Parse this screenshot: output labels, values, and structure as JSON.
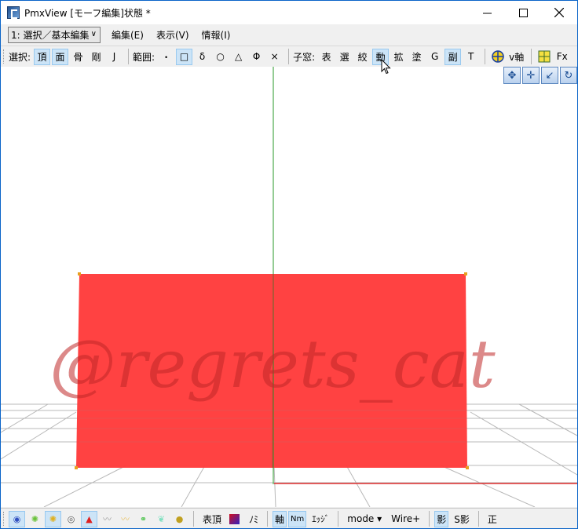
{
  "window": {
    "title": "PmxView  [モーフ編集]状態 *"
  },
  "titlebar": {
    "minimize": "—",
    "maximize": "☐",
    "close": "✕"
  },
  "menubar": {
    "mode_select": "1: 選択／基本編集",
    "items": [
      "編集(E)",
      "表示(V)",
      "情報(I)"
    ]
  },
  "toolbar": {
    "select_label": "選択:",
    "select_buttons": [
      {
        "label": "頂",
        "active": true
      },
      {
        "label": "面",
        "active": true
      },
      {
        "label": "骨",
        "active": false
      },
      {
        "label": "剛",
        "active": false
      },
      {
        "label": "J",
        "active": false
      }
    ],
    "range_label": "範囲:",
    "range_buttons": [
      {
        "label": "・",
        "active": false
      },
      {
        "label": "□",
        "active": true
      },
      {
        "label": "δ",
        "active": false
      },
      {
        "label": "○",
        "active": false
      },
      {
        "label": "△",
        "active": false
      },
      {
        "label": "Φ",
        "active": false
      },
      {
        "label": "×",
        "active": false
      }
    ],
    "child_label": "子窓:",
    "child_buttons": [
      {
        "label": "表",
        "active": false
      },
      {
        "label": "選",
        "active": false
      },
      {
        "label": "絞",
        "active": false
      },
      {
        "label": "動",
        "active": true
      },
      {
        "label": "拡",
        "active": false
      },
      {
        "label": "塗",
        "active": false
      },
      {
        "label": "G",
        "active": false
      },
      {
        "label": "副",
        "active": true
      },
      {
        "label": "T",
        "active": false
      }
    ],
    "vaxis_label": "v軸",
    "fx_label": "Fx"
  },
  "viewport": {
    "background": "#ffffff",
    "plane_color": "#ff3c3c",
    "watermark": "@regrets_cat"
  },
  "statusbar": {
    "icon_buttons": [
      {
        "name": "vertex-mode-icon",
        "glyph": "◉",
        "color": "#3050c0",
        "active": true
      },
      {
        "name": "burst-green-icon",
        "glyph": "✺",
        "color": "#6ac23a",
        "active": false
      },
      {
        "name": "burst-yellow-icon",
        "glyph": "✺",
        "color": "#e0b020",
        "active": true
      },
      {
        "name": "target-icon",
        "glyph": "◎",
        "color": "#555555",
        "active": false
      },
      {
        "name": "triangle-red-icon",
        "glyph": "▲",
        "color": "#e02020",
        "active": true
      },
      {
        "name": "zigzag-gray-icon",
        "glyph": "〰",
        "color": "#9a9a9a",
        "active": false
      },
      {
        "name": "zigzag-yellow-icon",
        "glyph": "〰",
        "color": "#e8c060",
        "active": false
      },
      {
        "name": "chain-green-icon",
        "glyph": "⚭",
        "color": "#40c040",
        "active": false
      },
      {
        "name": "leaf-cyan-icon",
        "glyph": "❦",
        "color": "#80e0c0",
        "active": false
      },
      {
        "name": "bear-icon",
        "glyph": "●",
        "color": "#c0a020",
        "active": false
      }
    ],
    "vertex_label": "表頂",
    "color_swatch": "#5020a0",
    "no_label": "ﾉﾐ",
    "axis_label": "軸",
    "nm_label": "Nm",
    "edge_label": "ｴｯｼﾞ",
    "mode_label": "mode ▾",
    "wire_label": "Wire+",
    "shadow_label": "影",
    "sshadow_label": "S影",
    "ortho_label": "正"
  }
}
